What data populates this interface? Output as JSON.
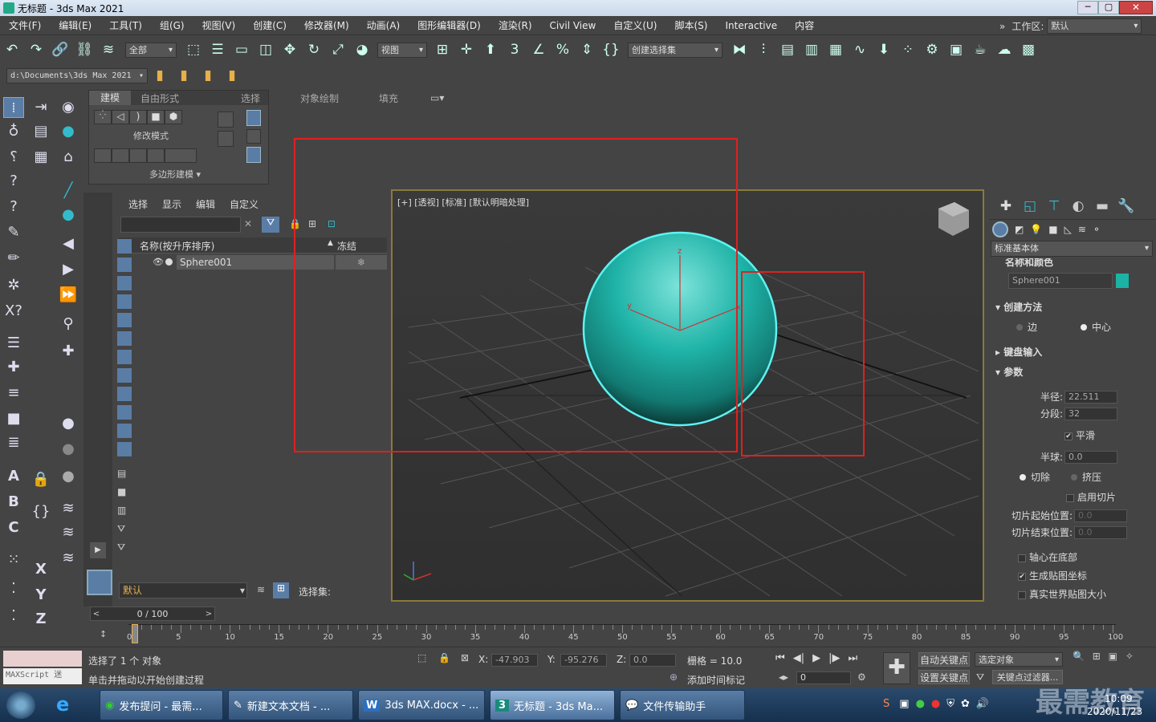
{
  "window": {
    "title": "无标题 - 3ds Max 2021"
  },
  "menu": [
    "文件(F)",
    "编辑(E)",
    "工具(T)",
    "组(G)",
    "视图(V)",
    "创建(C)",
    "修改器(M)",
    "动画(A)",
    "图形编辑器(D)",
    "渲染(R)",
    "Civil View",
    "自定义(U)",
    "脚本(S)",
    "Interactive",
    "内容"
  ],
  "workspace": {
    "label": "工作区:",
    "value": "默认"
  },
  "toolbar": {
    "filter": "全部",
    "refcoord": "视图",
    "selset": "创建选择集",
    "path": "d:\\Documents\\3ds Max 2021"
  },
  "ribbon": {
    "tabs": [
      "建模",
      "自由形式",
      "选择",
      "对象绘制",
      "填充"
    ],
    "mode": "修改模式",
    "poly": "多边形建模"
  },
  "scene": {
    "tabs": [
      "选择",
      "显示",
      "编辑",
      "自定义"
    ],
    "col_name": "名称(按升序排序)",
    "col_freeze": "冻结",
    "item": "Sphere001",
    "layer": "默认",
    "selset": "选择集:"
  },
  "viewport": {
    "label": "[+] [透视] [标准] [默认明暗处理]"
  },
  "cmd": {
    "category": "标准基本体",
    "name_color": "名称和颜色",
    "object_name": "Sphere001",
    "object_color": "#1bb3a6",
    "creation_method": "创建方法",
    "edge": "边",
    "center": "中心",
    "keyboard": "键盘输入",
    "params": "参数",
    "radius_label": "半径:",
    "radius": "22.511",
    "segments_label": "分段:",
    "segments": "32",
    "smooth": "平滑",
    "hemi_label": "半球:",
    "hemi": "0.0",
    "chop": "切除",
    "squash": "挤压",
    "slice_on": "启用切片",
    "slice_from_label": "切片起始位置:",
    "slice_from": "0.0",
    "slice_to_label": "切片结束位置:",
    "slice_to": "0.0",
    "base_pivot": "轴心在底部",
    "gen_map": "生成贴图坐标",
    "real_world": "真实世界贴图大小"
  },
  "timeline": {
    "frame": "0 / 100",
    "ticks": [
      "0",
      "5",
      "10",
      "15",
      "20",
      "25",
      "30",
      "35",
      "40",
      "45",
      "50",
      "55",
      "60",
      "65",
      "70",
      "75",
      "80",
      "85",
      "90",
      "95",
      "100"
    ]
  },
  "status": {
    "maxscript": "MAXScript 迷",
    "selected": "选择了 1 个 对象",
    "prompt": "单击并拖动以开始创建过程",
    "x_label": "X:",
    "x": "-47.903",
    "y_label": "Y:",
    "y": "-95.276",
    "z_label": "Z:",
    "z": "0.0",
    "grid": "栅格 = 10.0",
    "add_time_tag": "添加时间标记",
    "auto_key": "自动关键点",
    "set_key": "设置关键点",
    "selected_obj": "选定对象",
    "key_filters": "关键点过滤器...",
    "frame_field": "0"
  },
  "taskbar": {
    "items": [
      "发布提问 - 最需...",
      "新建文本文档 - ...",
      "3ds MAX.docx - ...",
      "无标题 - 3ds Ma...",
      "文件传输助手"
    ],
    "time": "10:09",
    "date": "2020/11/23",
    "watermark": "最需教育"
  }
}
